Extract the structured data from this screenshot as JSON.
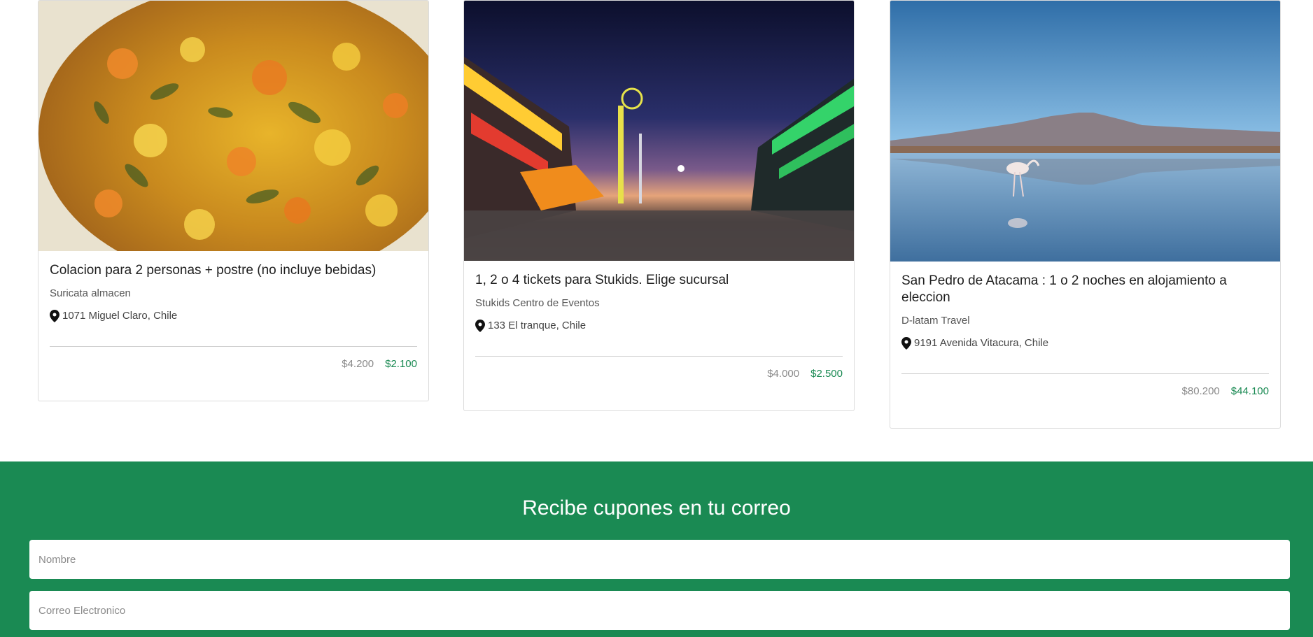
{
  "deals": [
    {
      "title": "Colacion para 2 personas + postre (no incluye bebidas)",
      "merchant": "Suricata almacen",
      "location": "1071 Miguel Claro, Chile",
      "old_price": "$4.200",
      "new_price": "$2.100",
      "image": "food-dish"
    },
    {
      "title": "1, 2 o 4 tickets para Stukids. Elige sucursal",
      "merchant": "Stukids Centro de Eventos",
      "location": "133 El tranque, Chile",
      "old_price": "$4.000",
      "new_price": "$2.500",
      "image": "amusement-fair-night"
    },
    {
      "title": "San Pedro de Atacama : 1 o 2 noches en alojamiento a eleccion",
      "merchant": "D-latam Travel",
      "location": "9191 Avenida Vitacura, Chile",
      "old_price": "$80.200",
      "new_price": "$44.100",
      "image": "flamingo-salt-lake"
    }
  ],
  "newsletter": {
    "title": "Recibe cupones en tu correo",
    "name_placeholder": "Nombre",
    "email_placeholder": "Correo Electronico"
  },
  "colors": {
    "brand_green": "#1a8a53",
    "old_price": "#8a8a8a"
  }
}
